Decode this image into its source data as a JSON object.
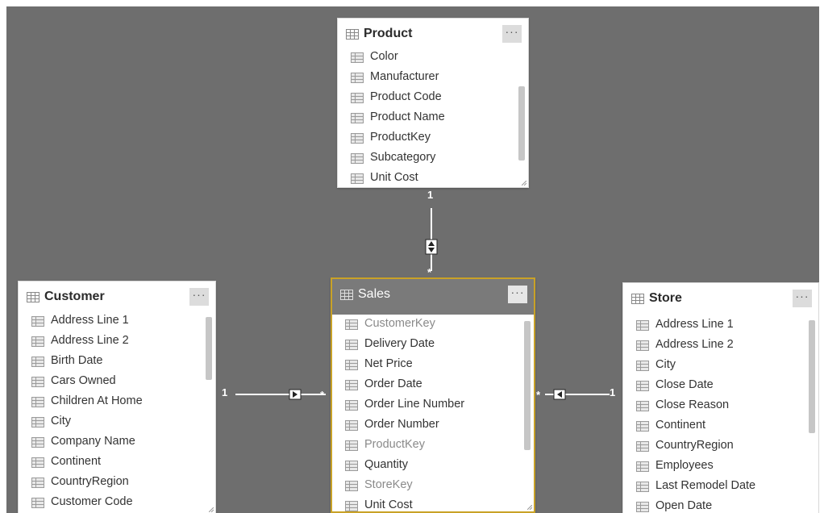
{
  "tables": {
    "product": {
      "name": "Product",
      "more_label": "···",
      "fields": [
        {
          "label": "Color"
        },
        {
          "label": "Manufacturer"
        },
        {
          "label": "Product Code"
        },
        {
          "label": "Product Name"
        },
        {
          "label": "ProductKey"
        },
        {
          "label": "Subcategory"
        },
        {
          "label": "Unit Cost"
        }
      ]
    },
    "customer": {
      "name": "Customer",
      "more_label": "···",
      "fields": [
        {
          "label": "Address Line 1"
        },
        {
          "label": "Address Line 2"
        },
        {
          "label": "Birth Date"
        },
        {
          "label": "Cars Owned"
        },
        {
          "label": "Children At Home"
        },
        {
          "label": "City"
        },
        {
          "label": "Company Name"
        },
        {
          "label": "Continent"
        },
        {
          "label": "CountryRegion"
        },
        {
          "label": "Customer Code"
        }
      ]
    },
    "sales": {
      "name": "Sales",
      "more_label": "···",
      "fields": [
        {
          "label": "CustomerKey",
          "hidden": true
        },
        {
          "label": "Delivery Date"
        },
        {
          "label": "Net Price"
        },
        {
          "label": "Order Date"
        },
        {
          "label": "Order Line Number"
        },
        {
          "label": "Order Number"
        },
        {
          "label": "ProductKey",
          "hidden": true
        },
        {
          "label": "Quantity"
        },
        {
          "label": "StoreKey",
          "hidden": true
        },
        {
          "label": "Unit Cost"
        }
      ]
    },
    "store": {
      "name": "Store",
      "more_label": "···",
      "fields": [
        {
          "label": "Address Line 1"
        },
        {
          "label": "Address Line 2"
        },
        {
          "label": "City"
        },
        {
          "label": "Close Date"
        },
        {
          "label": "Close Reason"
        },
        {
          "label": "Continent"
        },
        {
          "label": "CountryRegion"
        },
        {
          "label": "Employees"
        },
        {
          "label": "Last Remodel Date"
        },
        {
          "label": "Open Date"
        }
      ]
    }
  },
  "relationships": {
    "product_sales": {
      "one": "1",
      "many": "*",
      "direction": "both"
    },
    "customer_sales": {
      "one": "1",
      "many": "*",
      "direction": "single"
    },
    "store_sales": {
      "one": "1",
      "many": "*",
      "direction": "single"
    }
  },
  "colors": {
    "canvas": "#6e6e6e",
    "selected_border": "#c9a227",
    "selected_header": "#7a7a7a",
    "table_icon": "#9a9a9a"
  }
}
